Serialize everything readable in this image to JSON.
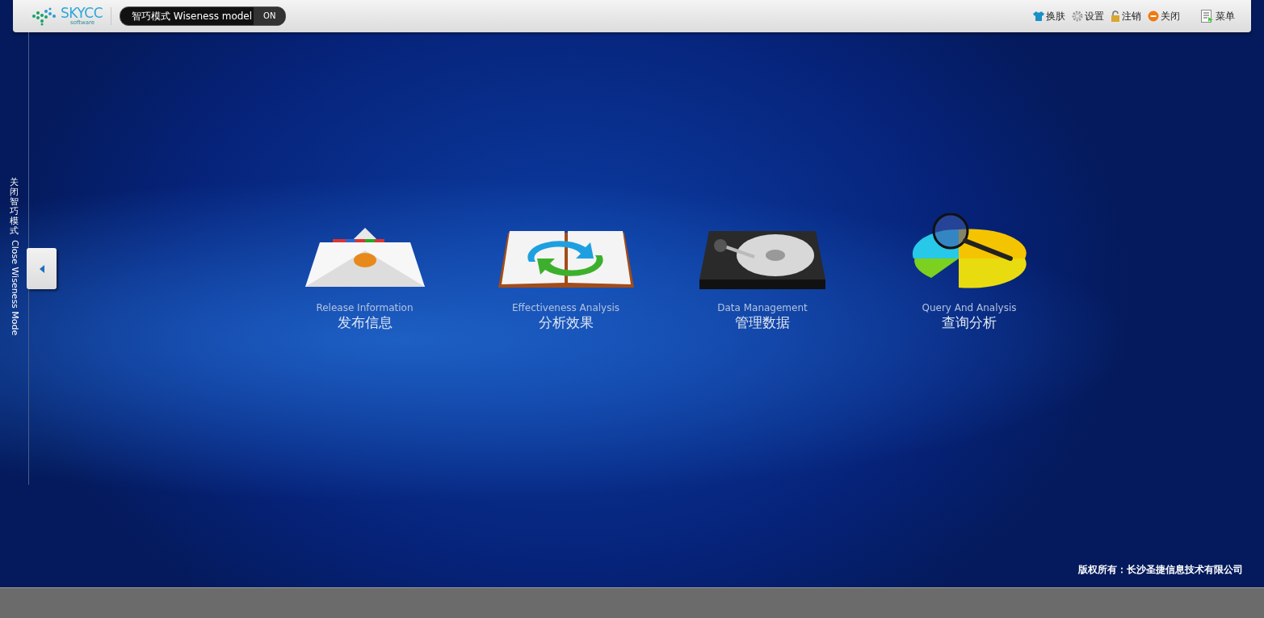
{
  "header": {
    "logo": {
      "name": "SKYCC",
      "tagline": "software"
    },
    "mode_toggle": {
      "label": "智巧模式 Wiseness model",
      "state_text": "ON",
      "on": true
    },
    "actions": [
      {
        "kind": "skin",
        "label": "换肤"
      },
      {
        "kind": "settings",
        "label": "设置"
      },
      {
        "kind": "logout",
        "label": "注销"
      },
      {
        "kind": "close",
        "label": "关闭"
      },
      {
        "kind": "menu",
        "label": "菜单"
      }
    ]
  },
  "sidebar": {
    "label_zh": "关闭智巧模式",
    "label_en": "Close Wiseness Mode"
  },
  "modules": [
    {
      "kind": "mail",
      "title_en": "Release Information",
      "title_zh": "发布信息"
    },
    {
      "kind": "book",
      "title_en": "Effectiveness Analysis",
      "title_zh": "分析效果"
    },
    {
      "kind": "disk",
      "title_en": "Data Management",
      "title_zh": "管理数据"
    },
    {
      "kind": "pie",
      "title_en": "Query And Analysis",
      "title_zh": "查询分析"
    }
  ],
  "footer": {
    "copyright": "版权所有：长沙圣捷信息技术有限公司"
  }
}
